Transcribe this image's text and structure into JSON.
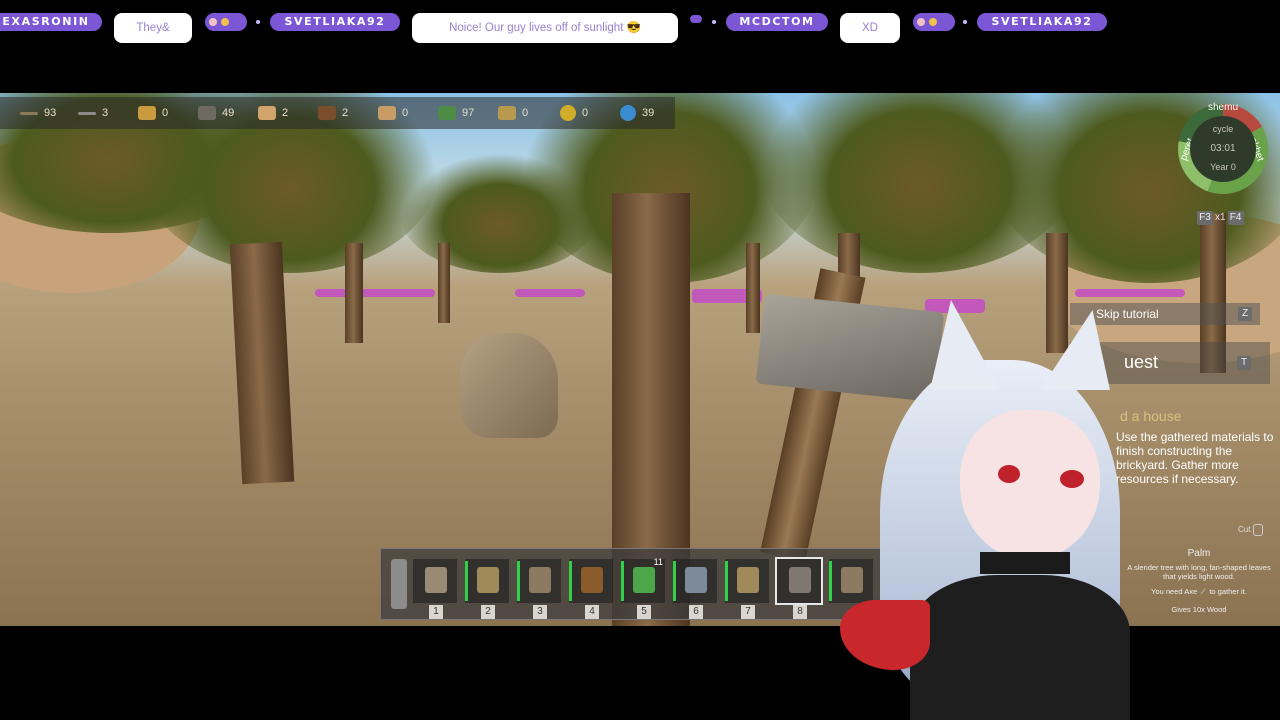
{
  "chat": {
    "users": [
      "EXASRONIN",
      "SVETLIAKA92",
      "MCDCTOM",
      "SVETLIAKA92"
    ],
    "messages": [
      "They&",
      "Noice! Our guy lives off of sunlight 😎",
      "XD"
    ]
  },
  "resources": [
    {
      "icon": "stick-icon",
      "value": "93"
    },
    {
      "icon": "stone-icon",
      "value": "3"
    },
    {
      "icon": "log-icon",
      "value": "0"
    },
    {
      "icon": "ore-icon",
      "value": "49"
    },
    {
      "icon": "plank-icon",
      "value": "2"
    },
    {
      "icon": "bark-icon",
      "value": "2"
    },
    {
      "icon": "brick-icon",
      "value": "0"
    },
    {
      "icon": "leaf-icon",
      "value": "97"
    },
    {
      "icon": "seed-icon",
      "value": "0"
    },
    {
      "icon": "gold-icon",
      "value": "0"
    },
    {
      "icon": "water-icon",
      "value": "39"
    }
  ],
  "minimap": {
    "cycle_label": "cycle",
    "time": "03:01",
    "year_label": "Year 0",
    "ring_left": "peret",
    "ring_right": "akhet",
    "ring_top": "shemu",
    "speed": [
      "F3",
      "x1",
      "F4"
    ]
  },
  "tutorial": {
    "skip_label": "Skip tutorial",
    "skip_key": "Z",
    "quest_title": "uest",
    "quest_key": "T",
    "task_title": "d a house",
    "task_text": "Use the gathered materials to finish constructing the brickyard. Gather more resources if necessary."
  },
  "hotbar": [
    {
      "num": "1",
      "tool": "stone-axe-icon",
      "meter": false,
      "stack": ""
    },
    {
      "num": "2",
      "tool": "sickle-icon",
      "meter": true,
      "stack": ""
    },
    {
      "num": "3",
      "tool": "pickaxe-icon",
      "meter": true,
      "stack": ""
    },
    {
      "num": "4",
      "tool": "bucket-icon",
      "meter": true,
      "stack": ""
    },
    {
      "num": "5",
      "tool": "seed-pouch-icon",
      "meter": true,
      "stack": "11"
    },
    {
      "num": "6",
      "tool": "jug-icon",
      "meter": true,
      "stack": ""
    },
    {
      "num": "7",
      "tool": "sickle-icon",
      "meter": true,
      "stack": ""
    },
    {
      "num": "8",
      "tool": "hammer-icon",
      "meter": false,
      "stack": ""
    },
    {
      "num": "",
      "tool": "pickaxe-icon",
      "meter": true,
      "stack": ""
    }
  ],
  "palm": {
    "cut_label": "Cut",
    "name": "Palm",
    "description": "A slender tree with long, fan-shaped leaves that yields light wood.",
    "need_prefix": "You need Axe",
    "need_suffix": "to gather it.",
    "gives": "Gives 10x Wood"
  },
  "colors": {
    "accent": "#7b57d6",
    "meter": "#31d04a"
  }
}
